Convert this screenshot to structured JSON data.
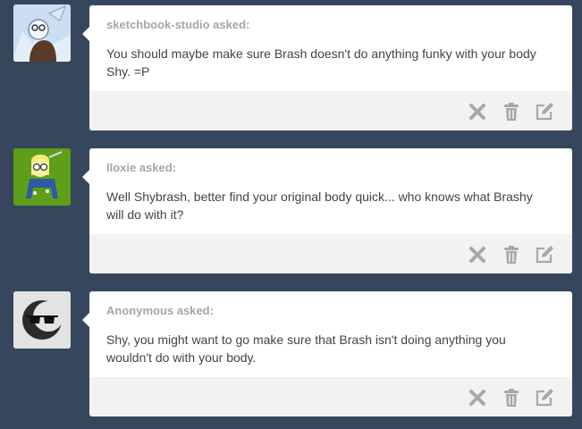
{
  "posts": [
    {
      "asker": "sketchbook-studio asked:",
      "question": "You should maybe make sure Brash doesn't do anything funky with your body Shy. =P",
      "avatar_icon": "pegasus-avatar-icon"
    },
    {
      "asker": "lloxie asked:",
      "question": "Well Shybrash, better find your original body quick... who knows what Brashy will do with it?",
      "avatar_icon": "pony-avatar-icon"
    },
    {
      "asker": "Anonymous asked:",
      "question": "Shy, you might want to go make sure that Brash isn't doing anything you wouldn't do with your body.",
      "avatar_icon": "anonymous-sunglasses-avatar-icon"
    }
  ],
  "actions": {
    "icons": [
      "close-icon",
      "trash-icon",
      "edit-icon"
    ]
  },
  "colors": {
    "background": "#36465d",
    "card": "#ffffff",
    "footer": "#f2f2f2",
    "asker_text": "#a6a6a6",
    "question_text": "#444444",
    "icon": "#a8a8a8"
  }
}
